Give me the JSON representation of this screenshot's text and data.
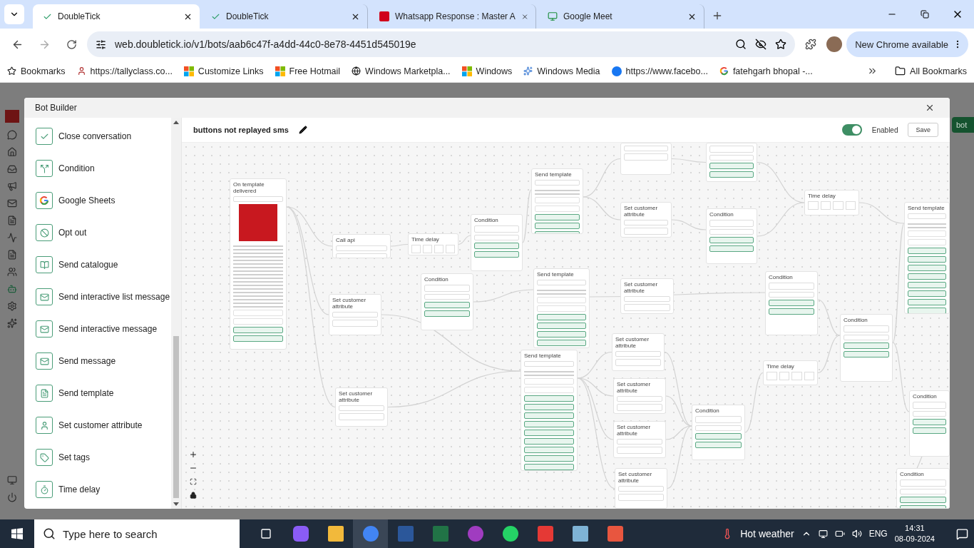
{
  "browser": {
    "tabs": [
      {
        "title": "DoubleTick",
        "kind": "tick",
        "selected": true
      },
      {
        "title": "DoubleTick",
        "kind": "tick",
        "selected": false
      },
      {
        "title": "Whatsapp Response : Master A",
        "kind": "response",
        "selected": false
      },
      {
        "title": "Google Meet",
        "kind": "meet",
        "selected": false
      }
    ],
    "url": "web.doubletick.io/v1/bots/aab6c47f-a4dd-44c0-8e78-4451d545019e",
    "update_button": "New Chrome available",
    "bookmarks": [
      {
        "label": "Bookmarks",
        "kind": "star"
      },
      {
        "label": "https://tallyclass.co...",
        "kind": "figure"
      },
      {
        "label": "Customize Links",
        "kind": "windows"
      },
      {
        "label": "Free Hotmail",
        "kind": "windows"
      },
      {
        "label": "Windows Marketpla...",
        "kind": "globe"
      },
      {
        "label": "Windows",
        "kind": "windows"
      },
      {
        "label": "Windows Media",
        "kind": "media"
      },
      {
        "label": "https://www.facebo...",
        "kind": "facebook"
      },
      {
        "label": "fatehgarh bhopal -...",
        "kind": "google"
      }
    ],
    "all_bookmarks": "All Bookmarks"
  },
  "app": {
    "side_button": "bot"
  },
  "dialog": {
    "title": "Bot Builder",
    "palette": [
      {
        "label": "Close conversation",
        "kind": "check"
      },
      {
        "label": "Condition",
        "kind": "split"
      },
      {
        "label": "Google Sheets",
        "kind": "google"
      },
      {
        "label": "Opt out",
        "kind": "ban"
      },
      {
        "label": "Send catalogue",
        "kind": "catalogue"
      },
      {
        "label": "Send interactive list message",
        "kind": "mail"
      },
      {
        "label": "Send interactive message",
        "kind": "mail"
      },
      {
        "label": "Send message",
        "kind": "mail"
      },
      {
        "label": "Send template",
        "kind": "template"
      },
      {
        "label": "Set customer attribute",
        "kind": "user"
      },
      {
        "label": "Set tags",
        "kind": "tag"
      },
      {
        "label": "Time delay",
        "kind": "timer"
      }
    ],
    "flow_name": "buttons not replayed sms",
    "enabled": true,
    "enabled_label": "Enabled",
    "save": "Save",
    "nodes": [
      {
        "kind": "trigger",
        "title": "On template delivered"
      },
      {
        "kind": "api",
        "title": "Call api"
      },
      {
        "kind": "delay",
        "title": "Time delay"
      },
      {
        "kind": "condition",
        "title": "Condition"
      },
      {
        "kind": "template",
        "title": "Send template"
      },
      {
        "kind": "attribute"
      },
      {
        "kind": "condition"
      },
      {
        "kind": "attribute",
        "title": "Set customer attribute"
      },
      {
        "kind": "condition",
        "title": "Condition"
      },
      {
        "kind": "delay",
        "title": "Time delay"
      },
      {
        "kind": "template",
        "title": "Send template"
      },
      {
        "kind": "attribute",
        "title": "Set customer attribute"
      },
      {
        "kind": "condition",
        "title": "Condition"
      },
      {
        "kind": "template",
        "title": "Send template"
      },
      {
        "kind": "attribute",
        "title": "Set customer attribute"
      },
      {
        "kind": "condition",
        "title": "Condition"
      },
      {
        "kind": "condition",
        "title": "Condition"
      },
      {
        "kind": "template",
        "title": "Send template"
      },
      {
        "kind": "attribute",
        "title": "Set customer attribute"
      },
      {
        "kind": "attribute",
        "title": "Set customer attribute"
      },
      {
        "kind": "attribute",
        "title": "Set customer attribute"
      },
      {
        "kind": "attribute",
        "title": "Set customer attribute"
      },
      {
        "kind": "condition",
        "title": "Condition"
      },
      {
        "kind": "delay",
        "title": "Time delay"
      },
      {
        "kind": "condition",
        "title": "Condition"
      },
      {
        "kind": "condition",
        "title": "Condition"
      },
      {
        "kind": "attribute",
        "title": "Set customer attribute"
      }
    ]
  },
  "taskbar": {
    "search_placeholder": "Type here to search",
    "weather": "Hot weather",
    "language": "ENG",
    "time": "14:31",
    "date": "08-09-2024"
  }
}
